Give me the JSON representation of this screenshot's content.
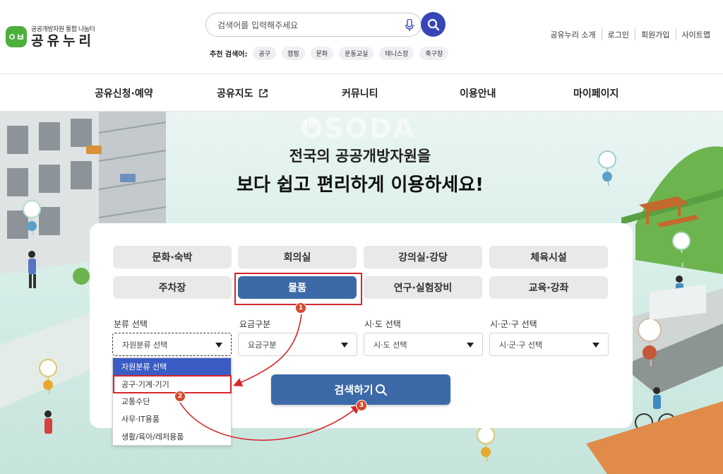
{
  "header": {
    "logo_mark": "ㅇㅂ",
    "logo_sub": "공공개방자원 통합 나눔터",
    "logo_main": "공유누리",
    "search_placeholder": "검색어를 입력해주세요",
    "recommend_label": "추천 검색어:",
    "tags": [
      "공구",
      "캠핑",
      "문화",
      "운동교실",
      "테니스장",
      "축구장"
    ],
    "links": [
      "공유누리 소개",
      "로그인",
      "회원가입",
      "사이트맵"
    ]
  },
  "nav": {
    "items": [
      "공유신청·예약",
      "공유지도",
      "커뮤니티",
      "이용안내",
      "마이페이지"
    ]
  },
  "hero": {
    "line1": "전국의 공공개방자원을",
    "line2": "보다 쉽고 편리하게 이용하세요!",
    "watermark": "OSODA",
    "watermark_small": "TIP"
  },
  "categories": [
    "문화·숙박",
    "회의실",
    "강의실·강당",
    "체육시설",
    "주차장",
    "물품",
    "연구·실험장비",
    "교육·강좌"
  ],
  "active_category": "물품",
  "filters": [
    {
      "label": "분류 선택",
      "value": "자원분류 선택"
    },
    {
      "label": "요금구분",
      "value": "요금구분"
    },
    {
      "label": "시·도 선택",
      "value": "시·도 선택"
    },
    {
      "label": "시·군·구 선택",
      "value": "시·군·구 선택"
    }
  ],
  "dropdown": {
    "options": [
      "자원분류 선택",
      "공구·기계·기기",
      "교통수단",
      "사무·IT용품",
      "생활/육아/레저용품"
    ]
  },
  "submit_label": "검색하기",
  "steps": [
    "1",
    "2",
    "3"
  ],
  "colors": {
    "primary": "#3c6aa8",
    "search_btn": "#3646b8",
    "annotation_red": "#d6262b",
    "logo_green": "#4caf3c"
  }
}
